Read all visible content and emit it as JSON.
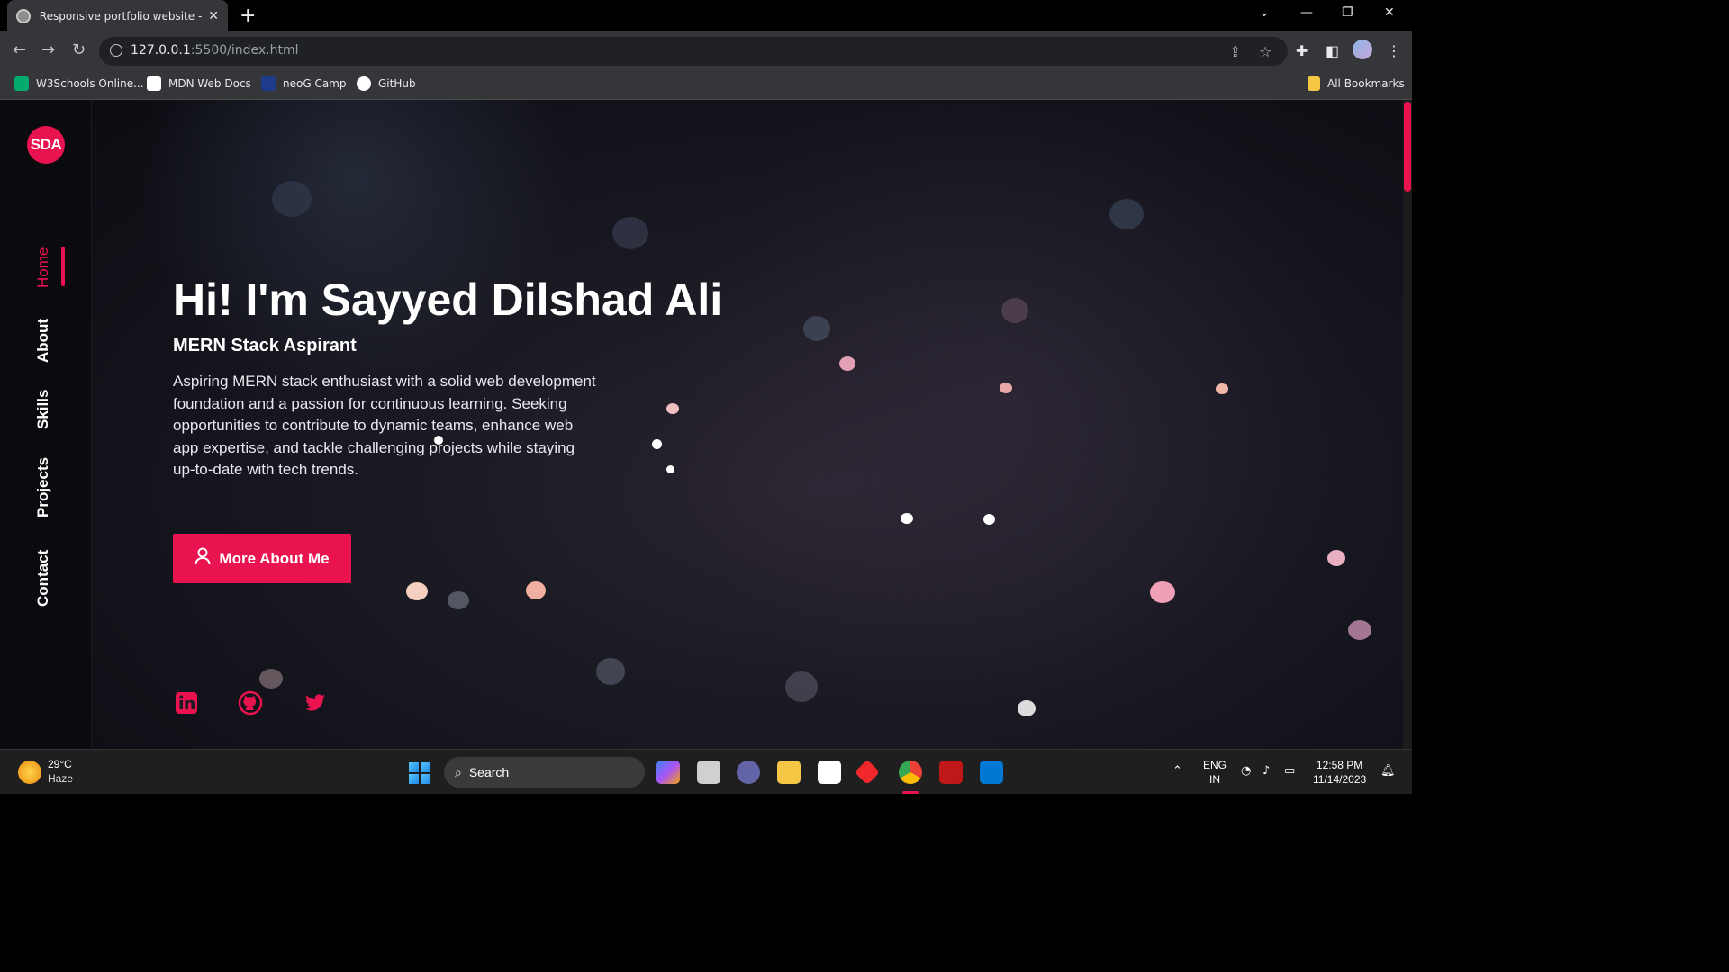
{
  "browser": {
    "tab_title": "Responsive portfolio website - C",
    "url_host": "127.0.0.1",
    "url_path": ":5500/index.html",
    "bookmarks": [
      "W3Schools Online...",
      "MDN Web Docs",
      "neoG Camp",
      "GitHub"
    ],
    "all_bookmarks": "All Bookmarks"
  },
  "site": {
    "logo": "SDA",
    "nav": [
      "Home",
      "About",
      "Skills",
      "Projects",
      "Contact"
    ],
    "active_nav": "Home",
    "headline": "Hi! I'm Sayyed Dilshad Ali",
    "subtitle": "MERN Stack Aspirant",
    "description": "Aspiring MERN stack enthusiast with a solid web development foundation and a passion for continuous learning. Seeking opportunities to contribute to dynamic teams, enhance web app expertise, and tackle challenging projects while staying up-to-date with tech trends.",
    "cta_label": "More About Me",
    "socials": [
      "linkedin-icon",
      "github-icon",
      "twitter-icon"
    ],
    "accent_color": "#e8134f"
  },
  "taskbar": {
    "temperature": "29°C",
    "weather": "Haze",
    "search_placeholder": "Search",
    "lang_line1": "ENG",
    "lang_line2": "IN",
    "time": "12:58 PM",
    "date": "11/14/2023"
  }
}
